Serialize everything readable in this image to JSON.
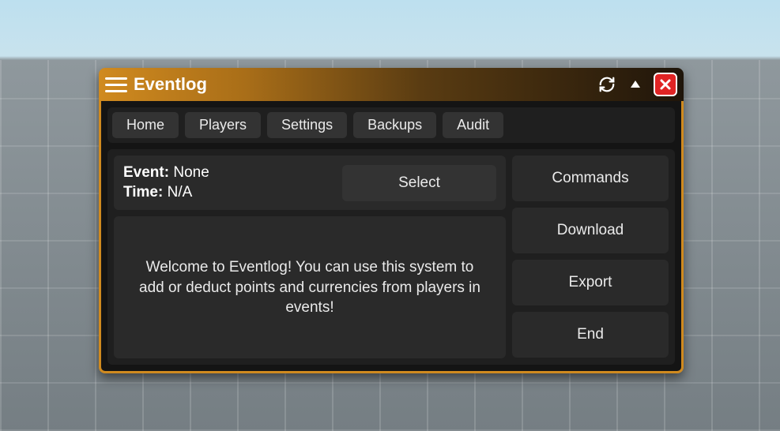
{
  "window": {
    "title": "Eventlog"
  },
  "tabs": {
    "home": "Home",
    "players": "Players",
    "settings": "Settings",
    "backups": "Backups",
    "audit": "Audit"
  },
  "info": {
    "event_label": "Event:",
    "event_value": "None",
    "time_label": "Time:",
    "time_value": "N/A",
    "select": "Select"
  },
  "welcome": "Welcome to Eventlog! You can use this system to add or deduct points and currencies from players in events!",
  "side": {
    "commands": "Commands",
    "download": "Download",
    "export": "Export",
    "end": "End"
  }
}
